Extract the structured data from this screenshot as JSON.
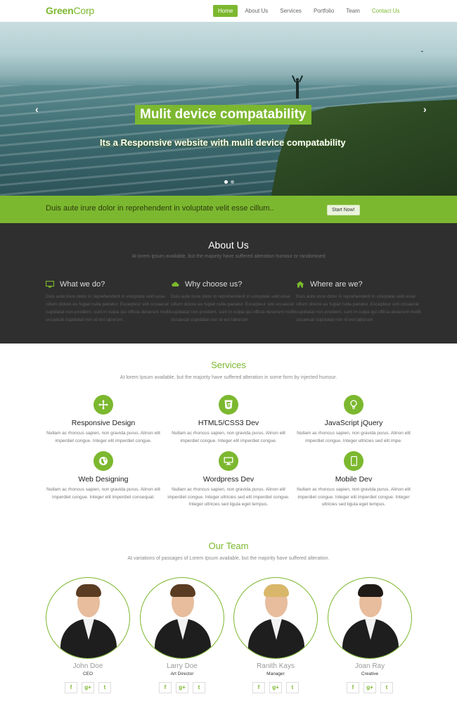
{
  "nav": {
    "logo_green": "Green",
    "logo_rest": "Corp",
    "items": [
      {
        "label": "Home"
      },
      {
        "label": "About Us"
      },
      {
        "label": "Services"
      },
      {
        "label": "Portfolio"
      },
      {
        "label": "Team"
      },
      {
        "label": "Contact Us"
      }
    ],
    "active_index": 0,
    "accent_color": "#7cb82f"
  },
  "hero": {
    "title": "Mulit device compatability",
    "subtitle": "Its a Responsive website with mulit device compatability",
    "prev_icon": "chevron-left-icon",
    "next_icon": "chevron-right-icon",
    "slide_count": 2,
    "active_slide": 0
  },
  "cta": {
    "text": "Duis aute irure dolor in reprehendent in voluptate velit esse cillum..",
    "button": "Start Now!"
  },
  "about": {
    "title": "About Us",
    "subtitle": "At lorem ipsum available, but the majority have suffered alteration humour or randomised",
    "columns": [
      {
        "icon": "monitor-icon",
        "title": "What we do?",
        "text": "Duis aute irure dolor in reprehenderit in voluptate velit esse cillum dolore eu fugiat nulla pariatur. Excepteur sint occaecat cupidatat non proident, sunt in culpa qui officia deserunt mollit occaecat cupidatat non id est laborum."
      },
      {
        "icon": "cloud-icon",
        "title": "Why choose us?",
        "text": "Duis aute irure dolor in reprehenderit in voluptate velit esse cillum dolore eu fugiat nulla pariatur. Excepteur sint occaecat cupidatat non proident, sunt in culpa qui officia deserunt mollit occaecat cupidatat non id est laborum."
      },
      {
        "icon": "home-icon",
        "title": "Where are we?",
        "text": "Duis aute irure dolor in reprehenderit in voluptate velit esse cillum dolore eu fugiat nulla pariatur. Excepteur sint occaecat cupidatat non proident, sunt in culpa qui officia deserunt mollit occaecat cupidatat non id est laborum."
      }
    ]
  },
  "services": {
    "title": "Services",
    "subtitle": "At lorem Ipsum available, but the majority have suffered alteration in some form by injected humour.",
    "items": [
      {
        "icon": "arrows-move-icon",
        "name_a": "Responsive ",
        "name_b": "Design",
        "text": "Nullam ac rhoncus sapien, non gravida purus. Alinon elit imperdiet congue. Integer elit imperdiet congue."
      },
      {
        "icon": "html5-icon",
        "name_a": "HTML5/CSS3 ",
        "name_b": "Dev",
        "text": "Nullam ac rhoncus sapien, non gravida purus. Alinon elit imperdiet congue. Integer elit imperdiet congue."
      },
      {
        "icon": "lightbulb-icon",
        "name_a": "JavaScript ",
        "name_b": "jQuery",
        "text": "Nullam ac rhoncus sapien, non gravida purus. Alinon elit imperdiet congue. Integer ultricies sed elit impe."
      },
      {
        "icon": "globe-icon",
        "name_a": "Web ",
        "name_b": "Designing",
        "text": "Nullam ac rhoncus sapien, non gravida purus. Alinon elit imperdiet congue. Integer elit imperdiet consequat."
      },
      {
        "icon": "desktop-icon",
        "name_a": "Wordpress ",
        "name_b": "Dev",
        "text": "Nullam ac rhoncus sapien, non gravida purus. Alinon elit imperdiet congue. Integer ultricies sed elit imperdiet congue. Integer ultricies sed ligula eget tempus."
      },
      {
        "icon": "mobile-icon",
        "name_a": "Mobile ",
        "name_b": "Dev",
        "text": "Nullam ac rhoncus sapien, non gravida purus. Alinon elit imperdiet congue. Integer elit imperdiet congue. Integer ultricies sed ligula eget tempus."
      }
    ]
  },
  "team": {
    "title": "Our Team",
    "subtitle": "At variations of passages of Lorem Ipsum available, but the majority have suffered alteration.",
    "members": [
      {
        "name": "John Doe",
        "role": "CEO"
      },
      {
        "name": "Larry Doe",
        "role": "Art Director"
      },
      {
        "name": "Ranith Kays",
        "role": "Manager"
      },
      {
        "name": "Joan Ray",
        "role": "Creative"
      }
    ],
    "social_labels": [
      "f",
      "g+",
      "t"
    ]
  }
}
